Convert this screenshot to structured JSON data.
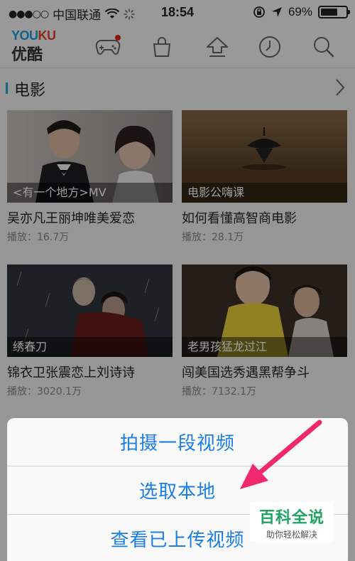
{
  "status_bar": {
    "carrier": "中国联通",
    "time": "18:54",
    "battery": "69%",
    "battery_level": 0.69
  },
  "app": {
    "logo_en_a": "YOU",
    "logo_en_b": "KU",
    "logo_zh": "优酷"
  },
  "nav_icons": [
    "game-controller-icon",
    "shopping-bag-icon",
    "upload-icon",
    "history-clock-icon",
    "search-icon"
  ],
  "section": {
    "title": "电影"
  },
  "videos": [
    {
      "caption": "<有一个地方>MV",
      "title": "吴亦凡王丽坤唯美爱恋",
      "plays": "播放：16.7万"
    },
    {
      "caption": "电影公嗨课",
      "title": "如何看懂高智商电影",
      "plays": "播放：28.1万"
    },
    {
      "caption": "绣春刀",
      "title": "锦衣卫张震恋上刘诗诗",
      "plays": "播放：3020.1万"
    },
    {
      "caption": "老男孩猛龙过江",
      "title": "闯美国选秀遇黑帮争斗",
      "plays": "播放：7132.1万"
    }
  ],
  "action_sheet": {
    "options": [
      "拍摄一段视频",
      "选取本地",
      "查看已上传视频"
    ]
  },
  "watermark": {
    "line1": "百科全说",
    "line2": "助你轻松解决"
  }
}
